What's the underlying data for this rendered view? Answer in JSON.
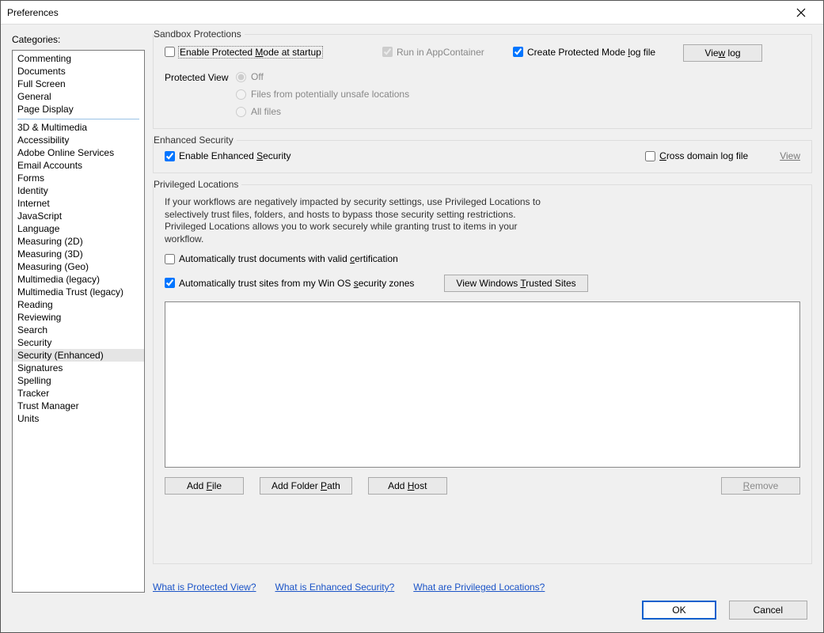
{
  "window": {
    "title": "Preferences"
  },
  "sidebar": {
    "label": "Categories:",
    "group1": [
      "Commenting",
      "Documents",
      "Full Screen",
      "General",
      "Page Display"
    ],
    "group2": [
      "3D & Multimedia",
      "Accessibility",
      "Adobe Online Services",
      "Email Accounts",
      "Forms",
      "Identity",
      "Internet",
      "JavaScript",
      "Language",
      "Measuring (2D)",
      "Measuring (3D)",
      "Measuring (Geo)",
      "Multimedia (legacy)",
      "Multimedia Trust (legacy)",
      "Reading",
      "Reviewing",
      "Search",
      "Security",
      "Security (Enhanced)",
      "Signatures",
      "Spelling",
      "Tracker",
      "Trust Manager",
      "Units"
    ],
    "selected": "Security (Enhanced)"
  },
  "sandbox": {
    "title": "Sandbox Protections",
    "enable_protected_pre": "Enable Protected ",
    "enable_protected_u": "M",
    "enable_protected_post": "ode at startup",
    "run_appcontainer": "Run in AppContainer",
    "create_log_pre": "Create Protected Mode ",
    "create_log_u": "l",
    "create_log_post": "og file",
    "view_log_pre": "Vie",
    "view_log_u": "w",
    "view_log_post": " log",
    "pv_label": "Protected View",
    "pv_off": "Off",
    "pv_unsafe": "Files from potentially unsafe locations",
    "pv_all": "All files"
  },
  "enhanced": {
    "title": "Enhanced Security",
    "enable_pre": "Enable Enhanced ",
    "enable_u": "S",
    "enable_post": "ecurity",
    "crossdomain_u": "C",
    "crossdomain_post": "ross domain log file",
    "view": "View"
  },
  "privileged": {
    "title": "Privileged Locations",
    "desc": "If your workflows are negatively impacted by security settings, use Privileged Locations to selectively trust files, folders, and hosts to bypass those security setting restrictions. Privileged Locations allows you to work securely while granting trust to items in your workflow.",
    "auto_cert_pre": "Automatically trust documents with valid ",
    "auto_cert_u": "c",
    "auto_cert_post": "ertification",
    "auto_os_pre": "Automatically trust sites from my Win OS ",
    "auto_os_u": "s",
    "auto_os_post": "ecurity zones",
    "view_trusted_pre": "View Windows ",
    "view_trusted_u": "T",
    "view_trusted_post": "rusted Sites",
    "add_file_pre": "Add ",
    "add_file_u": "F",
    "add_file_post": "ile",
    "add_folder_pre": "Add Folder ",
    "add_folder_u": "P",
    "add_folder_post": "ath",
    "add_host_pre": "Add ",
    "add_host_u": "H",
    "add_host_post": "ost",
    "remove_u": "R",
    "remove_post": "emove"
  },
  "help": {
    "protected_view": "What is Protected View?",
    "enhanced_security": "What is Enhanced Security?",
    "privileged_locations": "What are Privileged Locations?"
  },
  "footer": {
    "ok": "OK",
    "cancel": "Cancel"
  }
}
